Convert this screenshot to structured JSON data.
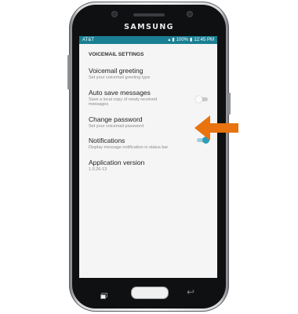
{
  "device": {
    "brand": "SAMSUNG"
  },
  "status_bar": {
    "carrier": "AT&T",
    "battery": "100%",
    "time": "12:45 PM",
    "color": "#1a7f93"
  },
  "screen": {
    "section_title": "VOICEMAIL SETTINGS",
    "items": [
      {
        "title": "Voicemail greeting",
        "subtitle": "Set your voicemail greeting type"
      },
      {
        "title": "Auto save messages",
        "subtitle": "Save a local copy of newly received messages",
        "toggle": "off"
      },
      {
        "title": "Change password",
        "subtitle": "Set your voicemail password"
      },
      {
        "title": "Notifications",
        "subtitle": "Display message notification in status bar",
        "toggle": "on"
      },
      {
        "title": "Application version",
        "subtitle": "1.0.26-13"
      }
    ]
  },
  "annotation": {
    "arrow_color": "#e8730f",
    "target": "Change password"
  }
}
